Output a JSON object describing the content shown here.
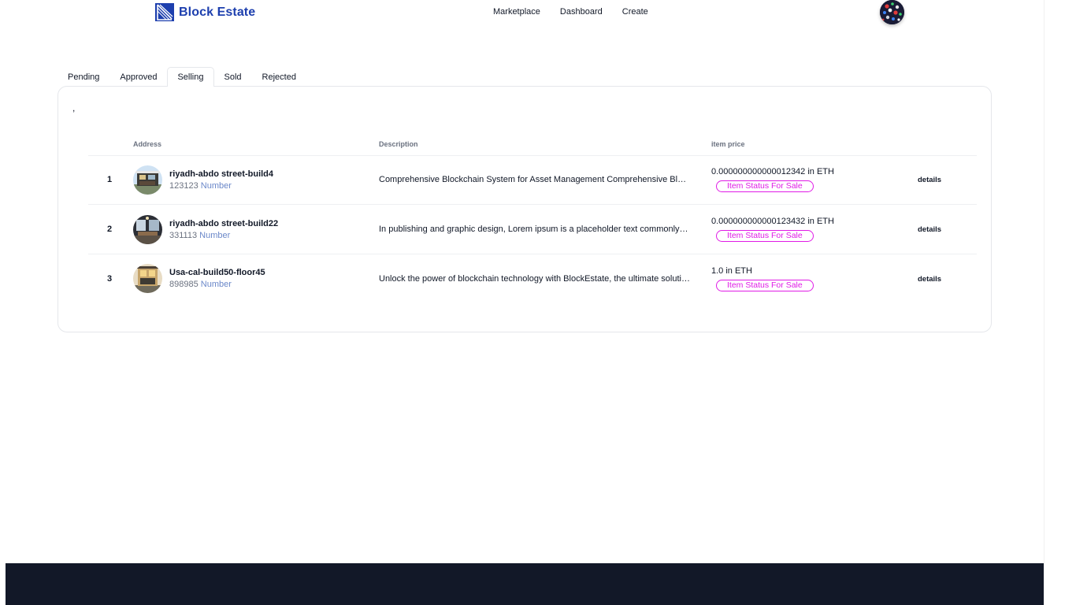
{
  "header": {
    "brand": "Block Estate",
    "nav": [
      "Marketplace",
      "Dashboard",
      "Create"
    ]
  },
  "tabs": [
    {
      "label": "Pending",
      "active": false
    },
    {
      "label": "Approved",
      "active": false
    },
    {
      "label": "Selling",
      "active": true
    },
    {
      "label": "Sold",
      "active": false
    },
    {
      "label": "Rejected",
      "active": false
    }
  ],
  "panel": {
    "stray_text": ",",
    "columns": {
      "number": "",
      "address": "Address",
      "description": "Description",
      "price": "item price",
      "actions": ""
    },
    "rows": [
      {
        "index": "1",
        "name": "riyadh-abdo street-build4",
        "code": "123123",
        "code_label": "Number",
        "description": "Comprehensive Blockchain System for Asset Management Comprehensive Blockchain System for Asset Management",
        "price": "0.000000000000012342 in ETH",
        "status": "Item Status For Sale",
        "action": "details"
      },
      {
        "index": "2",
        "name": "riyadh-abdo street-build22",
        "code": "331113",
        "code_label": "Number",
        "description": "In publishing and graphic design, Lorem ipsum is a placeholder text commonly used to demonstrate the visual form",
        "price": "0.000000000000123432 in ETH",
        "status": "Item Status For Sale",
        "action": "details"
      },
      {
        "index": "3",
        "name": "Usa-cal-build50-floor45",
        "code": "898985",
        "code_label": "Number",
        "description": "Unlock the power of blockchain technology with BlockEstate, the ultimate solution",
        "price": "1.0 in ETH",
        "status": "Item Status For Sale",
        "action": "details"
      }
    ]
  },
  "colors": {
    "brand": "#1d3fae",
    "status": "#e01be6",
    "footer": "#121828"
  },
  "icons": {
    "logo": "block-estate-logo-icon",
    "avatar": "user-avatar"
  }
}
